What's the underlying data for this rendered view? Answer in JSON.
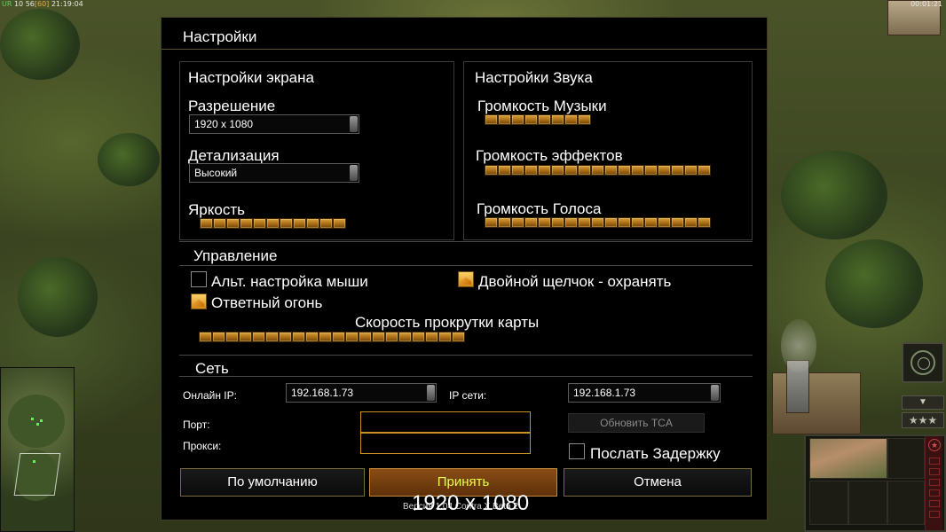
{
  "topbar": {
    "ur_label": "UR",
    "stats": "10 56",
    "fps": "[60]",
    "clock": "21:19:04",
    "game_timer": "00:01:21"
  },
  "dialog": {
    "title": "Настройки",
    "display": {
      "title": "Настройки экрана",
      "resolution_label": "Разрешение",
      "resolution_value": "1920 x 1080",
      "detail_label": "Детализация",
      "detail_value": "Высокий",
      "brightness_label": "Яркость",
      "brightness_level": 11
    },
    "sound": {
      "title": "Настройки Звука",
      "music_label": "Громкость Музыки",
      "music_level": 8,
      "effects_label": "Громкость эффектов",
      "effects_level": 17,
      "voice_label": "Громкость Голоса",
      "voice_level": 17
    },
    "controls": {
      "title": "Управление",
      "alt_mouse_label": "Альт. настройка мыши",
      "alt_mouse_checked": false,
      "double_click_label": "Двойной щелчок - охранять",
      "double_click_checked": true,
      "return_fire_label": "Ответный огонь",
      "return_fire_checked": true,
      "scroll_speed_label": "Скорость прокрутки карты",
      "scroll_speed_level": 20
    },
    "network": {
      "title": "Сеть",
      "online_ip_label": "Онлайн IP:",
      "online_ip_value": "192.168.1.73",
      "lan_ip_label": "IP сети:",
      "lan_ip_value": "192.168.1.73",
      "port_label": "Порт:",
      "port_value": "",
      "proxy_label": "Прокси:",
      "proxy_value": "",
      "update_tca_label": "Обновить TCA",
      "send_delay_label": "Послать Задержку",
      "send_delay_checked": false
    },
    "buttons": {
      "defaults": "По умолчанию",
      "accept": "Принять",
      "cancel": "Отмена"
    },
    "version_text": "Версия 1.04 Contra X Beta 2",
    "resolution_overlay": "1920 x 1080"
  },
  "hud": {
    "arrow_icon": "chevron-down-icon",
    "stars": "★★★",
    "radar_icon": "radar-icon"
  },
  "colors": {
    "slider_fill": "#c9861f",
    "primary_button": "#7a4214",
    "primary_text": "#e6ff4a",
    "accent_border": "#c9941e"
  }
}
